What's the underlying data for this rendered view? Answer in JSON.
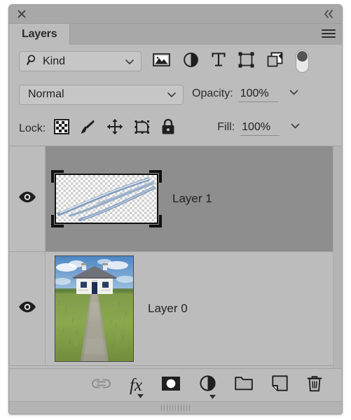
{
  "panel": {
    "title": "Layers",
    "close_icon": "close-icon",
    "collapse_icon": "collapse-double-chevron-icon",
    "menu_icon": "panel-menu-icon"
  },
  "filter_row": {
    "kind_label": "Kind",
    "search_icon": "search-icon",
    "caret_icon": "chevron-down-icon",
    "filter_icons": [
      {
        "name": "filter-pixel-layers-icon",
        "title": "Pixel layers"
      },
      {
        "name": "filter-adjustment-layers-icon",
        "title": "Adjustment layers"
      },
      {
        "name": "filter-type-layers-icon",
        "title": "Type layers"
      },
      {
        "name": "filter-shape-layers-icon",
        "title": "Shape layers"
      },
      {
        "name": "filter-smart-objects-icon",
        "title": "Smart objects"
      }
    ],
    "toggle_name": "filter-enable-toggle",
    "toggle_state": "off"
  },
  "blend_row": {
    "blend_mode": "Normal",
    "opacity_label": "Opacity:",
    "opacity_value": "100%",
    "caret_icon": "chevron-down-icon"
  },
  "lock_row": {
    "lock_label": "Lock:",
    "lock_icons": [
      {
        "name": "lock-transparent-pixels-icon",
        "title": "Lock transparent pixels"
      },
      {
        "name": "lock-image-pixels-icon",
        "title": "Lock image pixels"
      },
      {
        "name": "lock-position-icon",
        "title": "Lock position"
      },
      {
        "name": "lock-artboard-nesting-icon",
        "title": "Prevent auto-nesting"
      },
      {
        "name": "lock-all-icon",
        "title": "Lock all"
      }
    ],
    "fill_label": "Fill:",
    "fill_value": "100%",
    "caret_icon": "chevron-down-icon"
  },
  "layers": [
    {
      "name": "Layer 1",
      "selected": true,
      "visible": true,
      "thumbnail": "transparent-brush-strokes",
      "eye_icon": "eye-icon"
    },
    {
      "name": "Layer 0",
      "selected": false,
      "visible": true,
      "thumbnail": "cottage-photo",
      "eye_icon": "eye-icon"
    }
  ],
  "bottom_toolbar": [
    {
      "name": "link-layers-button",
      "label": "Link layers"
    },
    {
      "name": "layer-style-fx-button",
      "label": "fx"
    },
    {
      "name": "add-layer-mask-button",
      "label": "Add layer mask"
    },
    {
      "name": "new-adjustment-layer-button",
      "label": "New fill or adjustment layer"
    },
    {
      "name": "new-group-button",
      "label": "Create a new group"
    },
    {
      "name": "new-layer-button",
      "label": "Create a new layer"
    },
    {
      "name": "delete-layer-button",
      "label": "Delete layer"
    }
  ],
  "colors": {
    "panel_bg": "#bcbcbc",
    "titlebar_bg": "#a8a8a8",
    "selected_row": "#8e8e8e",
    "text": "#232323",
    "brush_stroke": "#6f8fb5"
  }
}
